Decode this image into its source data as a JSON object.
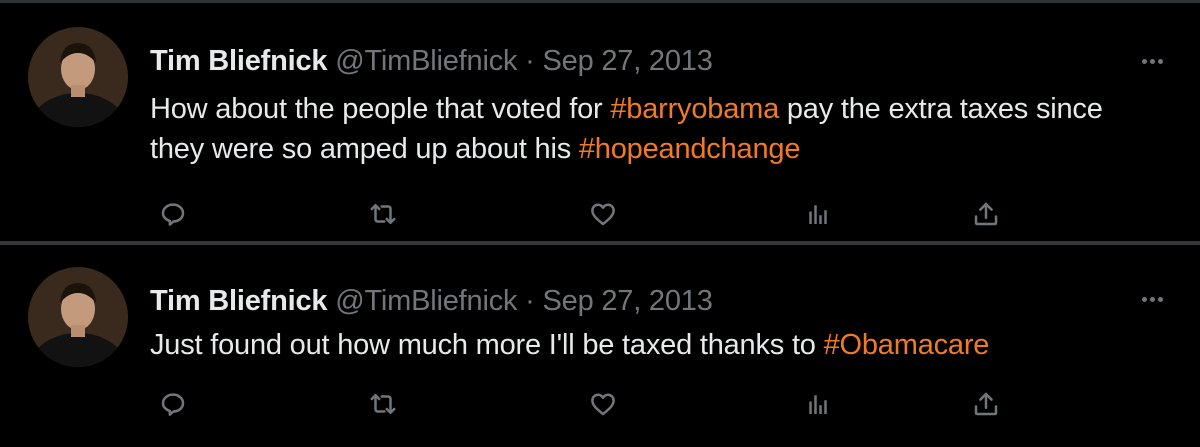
{
  "tweets": [
    {
      "author_name": "Tim Bliefnick",
      "handle": "@TimBliefnick",
      "separator": "·",
      "date": "Sep 27, 2013",
      "text_parts": [
        {
          "text": "How about the people that voted for ",
          "hashtag": false
        },
        {
          "text": "#barryobama",
          "hashtag": true
        },
        {
          "text": " pay the extra taxes since they were so amped up about his ",
          "hashtag": false
        },
        {
          "text": "#hopeandchange",
          "hashtag": true
        }
      ]
    },
    {
      "author_name": "Tim Bliefnick",
      "handle": "@TimBliefnick",
      "separator": "·",
      "date": "Sep 27, 2013",
      "text_parts": [
        {
          "text": "Just found out how much more I'll be taxed thanks to ",
          "hashtag": false
        },
        {
          "text": "#Obamacare",
          "hashtag": true
        }
      ]
    }
  ],
  "actions": [
    "reply-icon",
    "retweet-icon",
    "like-icon",
    "views-icon",
    "share-icon"
  ],
  "colors": {
    "background": "#000000",
    "text": "#e7e9ea",
    "muted": "#71767b",
    "hashtag": "#f07b24",
    "separator": "#2f3336"
  }
}
